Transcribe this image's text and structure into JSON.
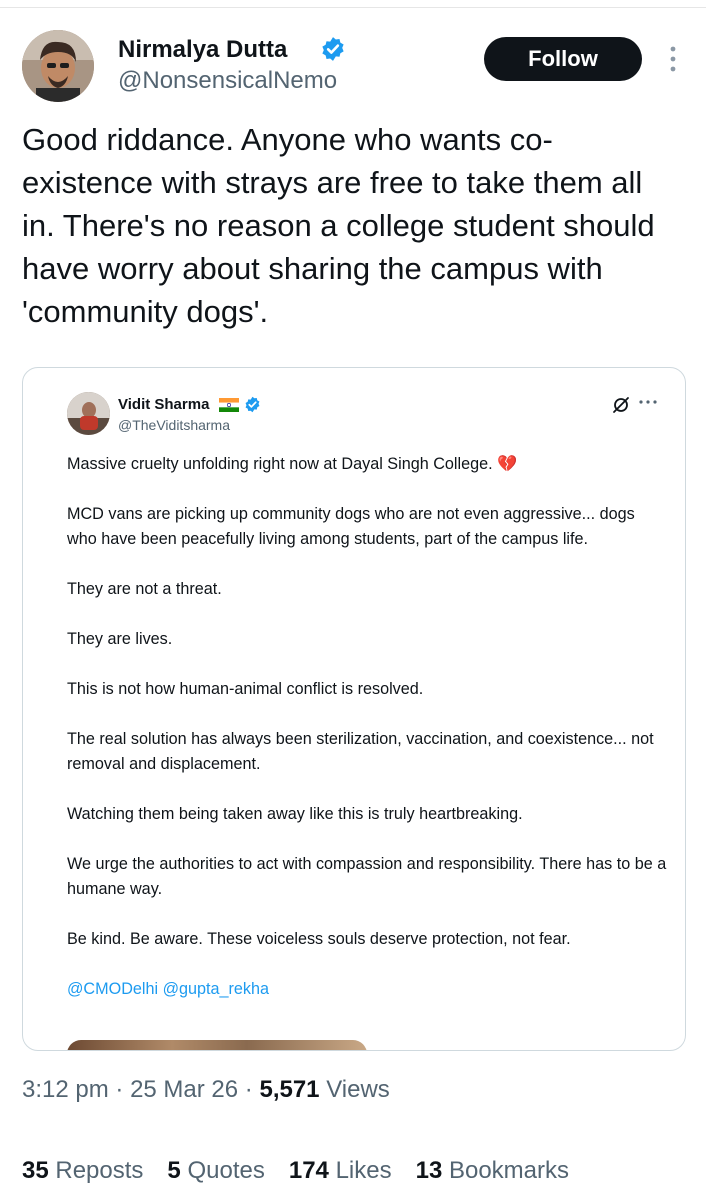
{
  "author": {
    "name": "Nirmalya Dutta",
    "handle": "@NonsensicalNemo",
    "follow_label": "Follow"
  },
  "tweet": {
    "text": "Good riddance. Anyone who wants co-existence with strays are free to take them all in. There's no reason a college student should have worry about sharing the campus with 'community dogs'."
  },
  "quoted": {
    "name": "Vidit Sharma",
    "handle": "@TheViditsharma",
    "paragraphs": [
      "Massive cruelty unfolding right now at Dayal Singh College. 💔",
      "MCD vans are picking up community dogs who are not even aggressive... dogs who have been peacefully living among students, part of the campus life.",
      "They are not a threat.",
      "They are lives.",
      "This is not how human-animal conflict is resolved.",
      "The real solution has always been  sterilization, vaccination, and coexistence... not removal and displacement.",
      "Watching them being taken away like this is truly heartbreaking.",
      "We urge the authorities to act with compassion and responsibility. There has to be a humane way.",
      "Be kind. Be aware. These voiceless souls deserve protection, not fear."
    ],
    "mentions": "@CMODelhi @gupta_rekha"
  },
  "meta": {
    "time": "3:12 pm",
    "date": "25 Mar 26",
    "views_count": "5,571",
    "views_label": "Views"
  },
  "stats": {
    "reposts_count": "35",
    "reposts_label": "Reposts",
    "quotes_count": "5",
    "quotes_label": "Quotes",
    "likes_count": "174",
    "likes_label": "Likes",
    "bookmarks_count": "13",
    "bookmarks_label": "Bookmarks"
  },
  "colors": {
    "text": "#0f1419",
    "secondary": "#536471",
    "accent": "#1d9bf0",
    "border": "#cfd9de",
    "follow_bg": "#0f1419"
  },
  "icons": {
    "verified": "verified-badge-icon",
    "more": "more-vertical-icon",
    "flag": "india-flag-icon",
    "grok": "grok-icon",
    "more_h": "more-horizontal-icon"
  }
}
